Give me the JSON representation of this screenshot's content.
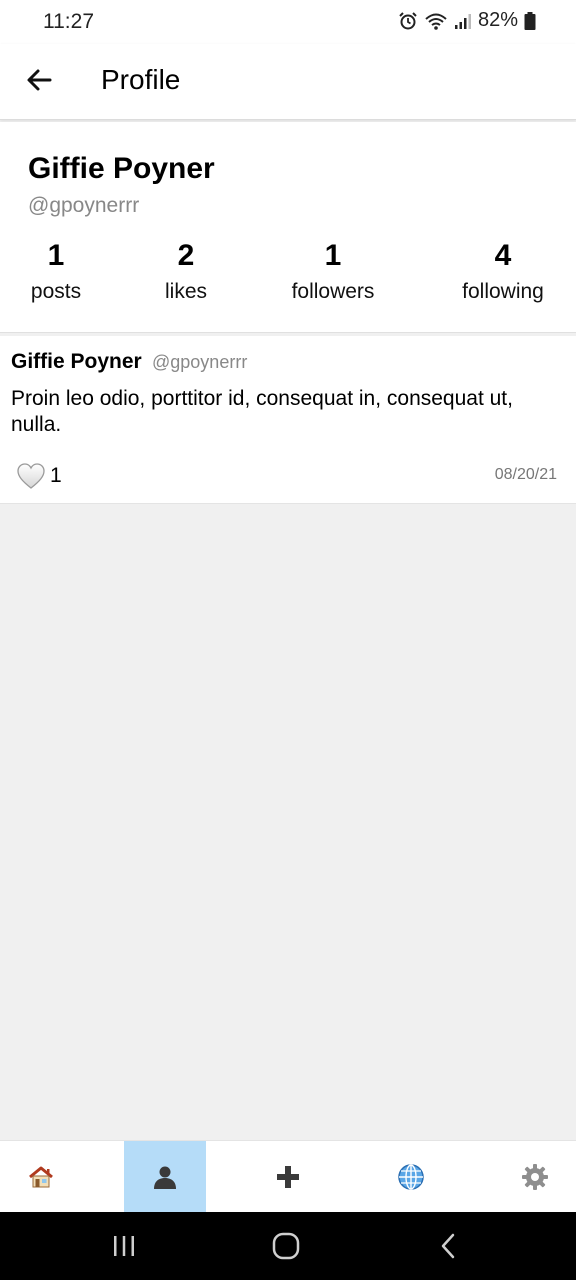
{
  "status_bar": {
    "time": "11:27",
    "battery": "82%"
  },
  "app_bar": {
    "title": "Profile",
    "back_icon": "arrow-left-icon"
  },
  "profile": {
    "name": "Giffie Poyner",
    "handle": "@gpoynerrr",
    "stats": [
      {
        "value": "1",
        "label": "posts"
      },
      {
        "value": "2",
        "label": "likes"
      },
      {
        "value": "1",
        "label": "followers"
      },
      {
        "value": "4",
        "label": "following"
      }
    ]
  },
  "posts": [
    {
      "author": "Giffie Poyner",
      "handle": "@gpoynerrr",
      "body": "Proin leo odio, porttitor id, consequat in, consequat ut, nulla.",
      "likes": "1",
      "date": "08/20/21"
    }
  ],
  "bottom_nav": [
    {
      "icon": "home-icon",
      "active": false
    },
    {
      "icon": "profile-icon",
      "active": true
    },
    {
      "icon": "plus-icon",
      "active": false
    },
    {
      "icon": "globe-icon",
      "active": false
    },
    {
      "icon": "gear-icon",
      "active": false
    }
  ],
  "colors": {
    "active_tab": "#b5dcf8",
    "background": "#f0f0f0"
  }
}
